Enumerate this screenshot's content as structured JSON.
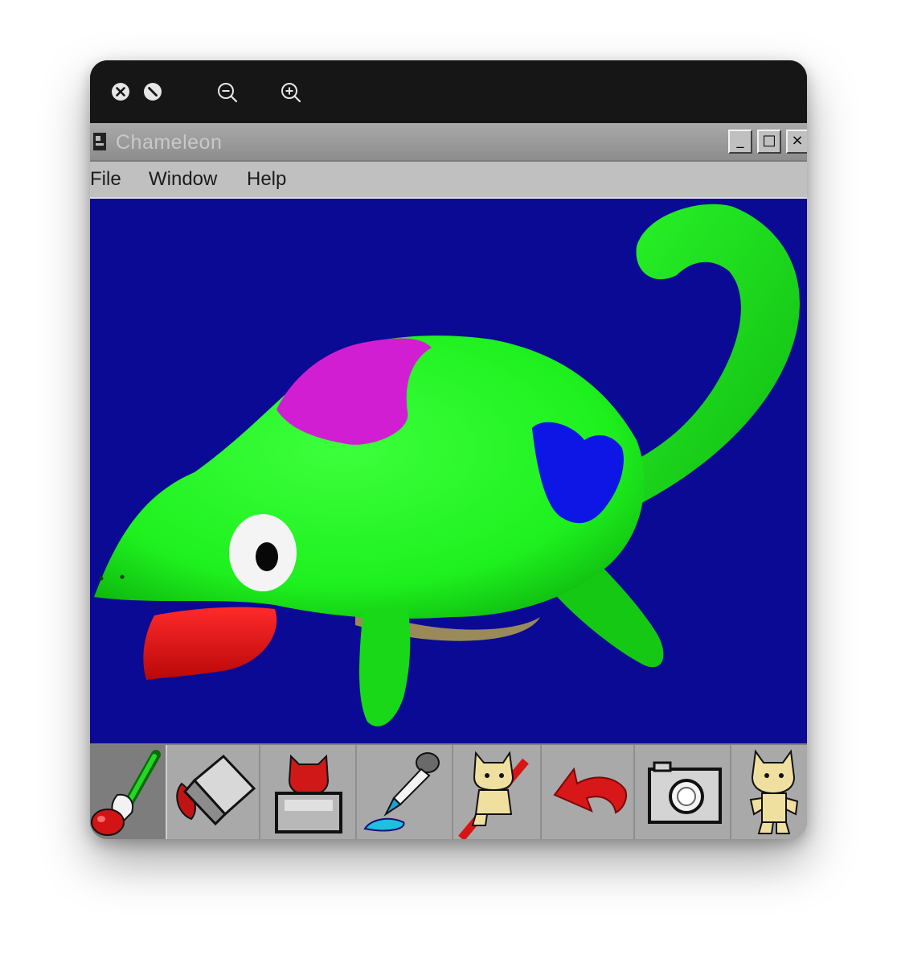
{
  "app": {
    "title": "Chameleon",
    "menu": [
      "File",
      "Window",
      "Help"
    ]
  },
  "viewer_toolbar": {
    "icons": [
      "close-icon",
      "block-icon",
      "zoom-out-icon",
      "zoom-in-icon"
    ]
  },
  "canvas": {
    "background_color": "#0a0a94",
    "body_color": "#1ef01e",
    "spot_colors": [
      "#d21ed2",
      "#0e16e6"
    ],
    "tongue_color": "#e01010"
  },
  "tools": [
    {
      "name": "brush-tool",
      "icon": "paintbrush-icon",
      "active": true
    },
    {
      "name": "eraser-tool",
      "icon": "eraser-icon",
      "active": false
    },
    {
      "name": "stamp-tool",
      "icon": "stamp-icon",
      "active": false
    },
    {
      "name": "eyedropper-tool",
      "icon": "eyedropper-icon",
      "active": false
    },
    {
      "name": "clear-tool",
      "icon": "cat-clear-icon",
      "active": false
    },
    {
      "name": "undo-tool",
      "icon": "undo-arrow-icon",
      "active": false
    },
    {
      "name": "snapshot-tool",
      "icon": "camera-icon",
      "active": false
    },
    {
      "name": "character-tool",
      "icon": "cat-character-icon",
      "active": false
    }
  ]
}
